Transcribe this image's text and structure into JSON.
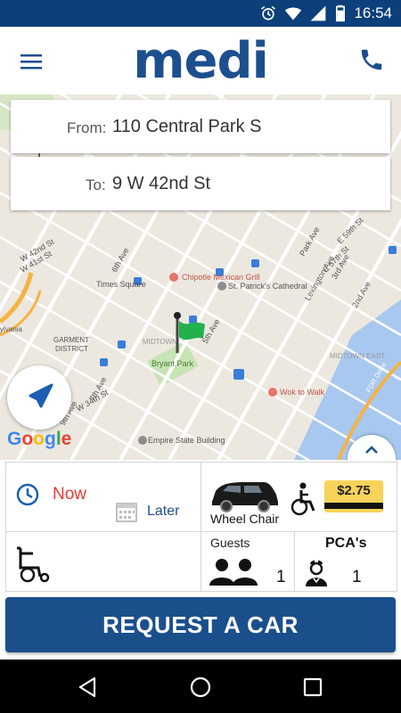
{
  "status_bar": {
    "time": "16:54",
    "icons": [
      "alarm-icon",
      "wifi-icon",
      "cell-signal-icon",
      "battery-icon"
    ]
  },
  "app_bar": {
    "logo_text": "medi",
    "menu_icon": "hamburger-menu-icon",
    "call_icon": "phone-icon"
  },
  "route": {
    "from_label": "From:",
    "from_value": "110 Central Park S",
    "to_label": "To:",
    "to_value": "9 W 42nd St"
  },
  "map": {
    "labels": {
      "times_square": "Times Square",
      "chipotle": "Chipotle Mexican Grill",
      "st_patricks": "St. Patrick's Cathedral",
      "garment_district": "GARMENT\nDISTRICT",
      "midtown": "MIDTOWN",
      "bryant_park": "Bryant Park",
      "midtown_east": "MIDTOWN EAST",
      "wok_to_walk": "Wok to Walk",
      "empire_state": "Empire State Building",
      "ave_6th": "6th Ave",
      "ave_7th": "7th Ave",
      "ave_5th": "5th Ave",
      "ave_9th": "9th Ave",
      "ave_park": "Park Ave",
      "ave_lexington": "Lexington Ave",
      "ave_3rd": "3rd Ave",
      "ave_2nd": "2nd Ave",
      "st_w42": "W 42nd St",
      "st_w41": "W 41st St",
      "st_w34": "W 34th St",
      "st_e59": "E 59th St",
      "st_e57": "E 57th St",
      "fdr": "FDR Drive",
      "pennsylvania": "ylvania"
    },
    "google_logo": [
      "G",
      "o",
      "o",
      "g",
      "l",
      "e"
    ],
    "google_colors": [
      "#4285F4",
      "#EA4335",
      "#FBBC05",
      "#4285F4",
      "#34A853",
      "#EA4335"
    ],
    "destination_flag_color": "#22b14c"
  },
  "booking": {
    "now_label": "Now",
    "later_label": "Later",
    "vehicle_label": "Wheel Chair",
    "price": "$2.75",
    "guests_label": "Guests",
    "guests_count": "1",
    "pca_label": "PCA's",
    "pca_count": "1"
  },
  "request_button": "REQUEST A CAR",
  "colors": {
    "brand_blue": "#1b4f8c",
    "status_bar": "#0d3f7a",
    "accent_red": "#e53935",
    "price_yellow": "#f7d35a"
  }
}
